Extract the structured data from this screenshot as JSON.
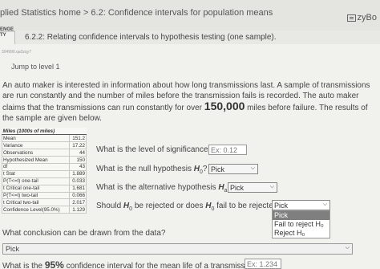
{
  "header": {
    "breadcrumb": "plied Statistics home > 6.2: Confidence intervals for population means",
    "brand": "zyBo",
    "side_label": "ENGE\nTY"
  },
  "section": {
    "title": "6.2.2: Relating confidence intervals to hypothesis testing (one sample)."
  },
  "small_id": "304990.qa3zqy7",
  "jump_label": "Jump to level 1",
  "intro": {
    "text": "An auto maker is interested in information about how long transmissions last. A sample of transmissions are run constantly and the number of miles before the transmission fails is recorded. The auto maker claims that the transmissions can run constantly for over ",
    "number": "150,000",
    "tail": " miles before failure. The results of the sample are given below."
  },
  "table": {
    "header": "Miles (1000s of miles)",
    "rows": [
      {
        "label": "Mean",
        "value": "151.2"
      },
      {
        "label": "Variance",
        "value": "17.22"
      },
      {
        "label": "Observations",
        "value": "44"
      },
      {
        "label": "Hypothesized Mean",
        "value": "150"
      },
      {
        "label": "df",
        "value": "43"
      },
      {
        "label": "t Stat",
        "value": "1.889"
      },
      {
        "label": "P(T<=t) one-tail",
        "value": "0.033"
      },
      {
        "label": "t Critical one-tail",
        "value": "1.681"
      },
      {
        "label": "P(T<=t) two-tail",
        "value": "0.066"
      },
      {
        "label": "t Critical two-tail",
        "value": "2.017"
      },
      {
        "label": "Confidence Level(95.0%)",
        "value": "1.129"
      }
    ]
  },
  "questions": {
    "significance": {
      "text": "What is the level of significance?",
      "placeholder": "Ex: 0.12"
    },
    "null": {
      "prefix": "What is the null hypothesis ",
      "symbol": "H",
      "sub": "0",
      "suffix": "?",
      "select": "Pick"
    },
    "alt": {
      "prefix": "What is the alternative hypothesis ",
      "symbol": "H",
      "sub": "a",
      "suffix": "?",
      "select": "Pick"
    },
    "reject": {
      "prefix": "Should ",
      "symbol": "H",
      "sub": "0",
      "suffix": " be rejected or does ",
      "suffix2": " fail to be rejected?",
      "select": "Pick"
    },
    "conclusion": {
      "text": "What conclusion can be drawn from the data?",
      "select": "Pick"
    },
    "ci": {
      "prefix": "What is the ",
      "pct": "95%",
      "suffix": " confidence interval for the mean life of a transmission?",
      "placeholder": "Ex: 1.234"
    }
  },
  "dropdown_options": [
    "Pick",
    "Fail to reject H₀",
    "Reject H₀"
  ]
}
